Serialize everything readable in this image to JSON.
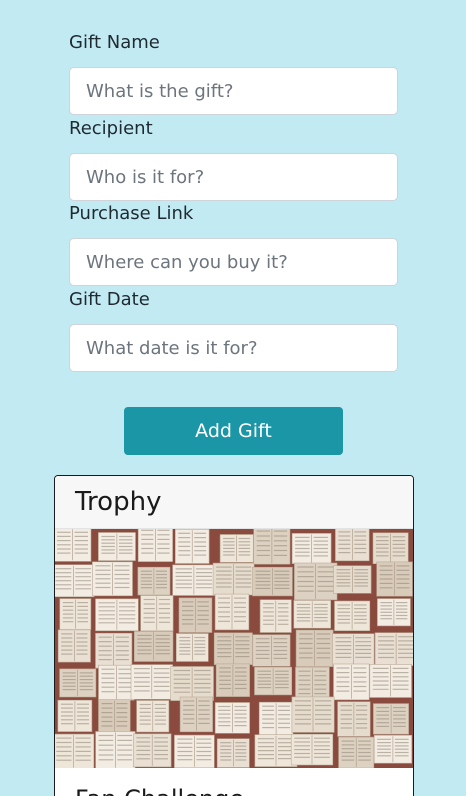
{
  "form": {
    "fields": [
      {
        "label": "Gift Name",
        "placeholder": "What is the gift?",
        "value": ""
      },
      {
        "label": "Recipient",
        "placeholder": "Who is it for?",
        "value": ""
      },
      {
        "label": "Purchase Link",
        "placeholder": "Where can you buy it?",
        "value": ""
      },
      {
        "label": "Gift Date",
        "placeholder": "What date is it for?",
        "value": ""
      }
    ],
    "submit_label": "Add Gift"
  },
  "colors": {
    "background": "#c2eaf3",
    "button": "#1b96a6"
  },
  "gift_card": {
    "title": "Trophy",
    "image_icon": "open-books-collage-image",
    "subtitle": "Fan Challenge"
  }
}
